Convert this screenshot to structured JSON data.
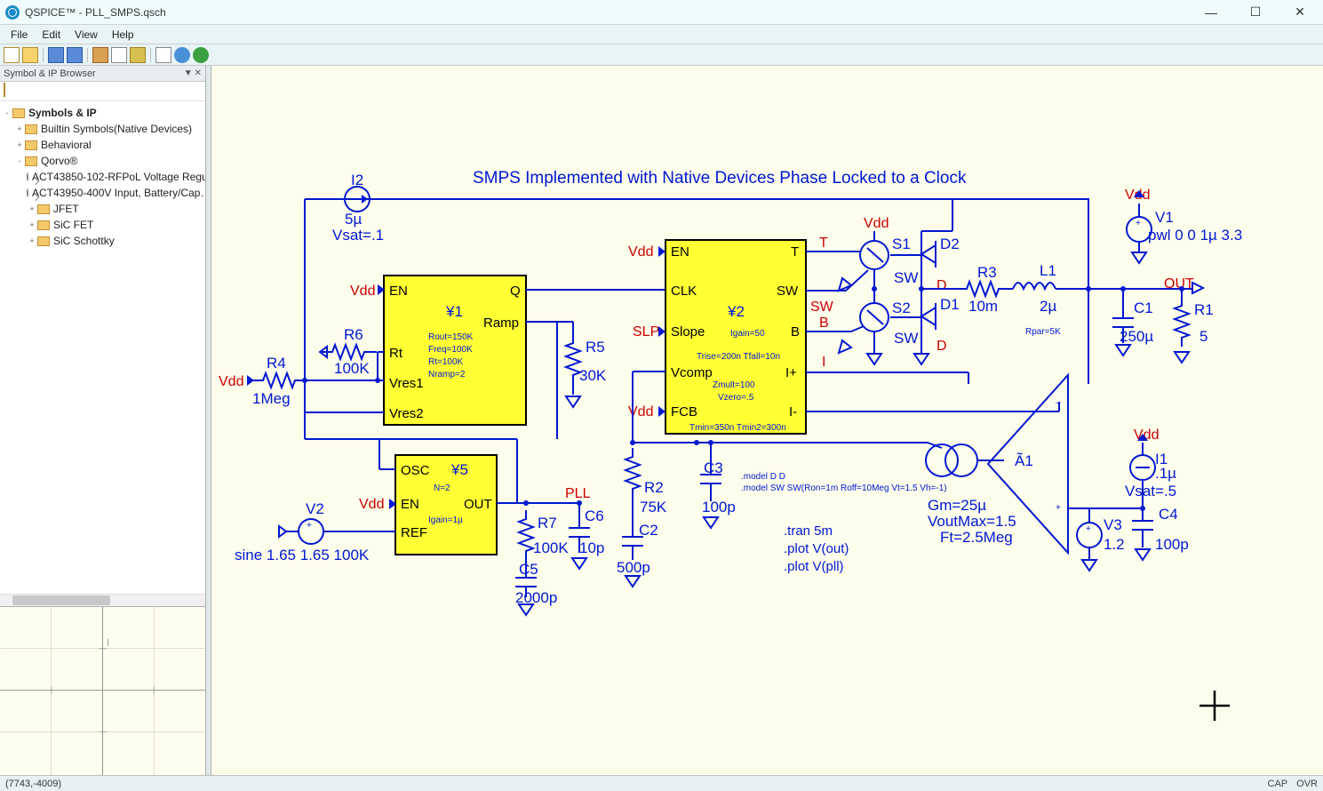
{
  "window": {
    "title": "QSPICE™ - PLL_SMPS.qsch"
  },
  "menus": [
    "File",
    "Edit",
    "View",
    "Help"
  ],
  "sidebar": {
    "title": "Symbol & IP Browser",
    "root": "Symbols & IP",
    "nodes": [
      {
        "label": "Builtin Symbols(Native Devices)",
        "indent": 1,
        "type": "folder",
        "toggle": "+"
      },
      {
        "label": "Behavioral",
        "indent": 1,
        "type": "folder",
        "toggle": "+"
      },
      {
        "label": "Qorvo®",
        "indent": 1,
        "type": "folder",
        "toggle": "-"
      },
      {
        "label": "ACT43850-102-RFPoL Voltage Regu",
        "indent": 2,
        "type": "leaf",
        "toggle": ""
      },
      {
        "label": "ACT43950-400V Input, Battery/Cap…",
        "indent": 2,
        "type": "leaf",
        "toggle": ""
      },
      {
        "label": "JFET",
        "indent": 2,
        "type": "folder",
        "toggle": "+"
      },
      {
        "label": "SiC FET",
        "indent": 2,
        "type": "folder",
        "toggle": "+"
      },
      {
        "label": "SiC Schottky",
        "indent": 2,
        "type": "folder",
        "toggle": "+"
      }
    ]
  },
  "status": {
    "coords": "(7743,-4009)",
    "cap": "CAP",
    "ovr": "OVR"
  },
  "schematic": {
    "title": "SMPS Implemented with Native Devices Phase Locked to a Clock",
    "nets": {
      "vdd": "Vdd",
      "slp": "SLP",
      "pll": "PLL",
      "sw": "SW",
      "t": "T",
      "b": "B",
      "i": "I",
      "d": "D",
      "out": "OUT"
    },
    "comps": {
      "I2": {
        "ref": "I2",
        "val": "5µ",
        "note": "Vsat=.1"
      },
      "Y1": {
        "ref": "¥1",
        "pins": {
          "en": "EN",
          "q": "Q",
          "ramp": "Ramp",
          "rt": "Rt",
          "vres1": "Vres1",
          "vres2": "Vres2"
        },
        "params": [
          "Rout=150K",
          "Freq=100K",
          "Rt=100K",
          "Nramp=2"
        ]
      },
      "Y2": {
        "ref": "¥2",
        "pins": {
          "en": "EN",
          "t": "T",
          "clk": "CLK",
          "sw": "SW",
          "slope": "Slope",
          "b": "B",
          "vcomp": "Vcomp",
          "ip": "I+",
          "fcb": "FCB",
          "im": "I-"
        },
        "params": [
          "Igain=50",
          "Trise=200n Tfall=10n",
          "Zmult=100",
          "Vzero=.5",
          "Tmin=350n Tmin2=300n"
        ]
      },
      "Y5": {
        "ref": "¥5",
        "pins": {
          "osc": "OSC",
          "en": "EN",
          "out": "OUT",
          "ref": "REF"
        },
        "params": [
          "N=2",
          "Igain=1µ"
        ]
      },
      "R4": {
        "ref": "R4",
        "val": "1Meg"
      },
      "R6": {
        "ref": "R6",
        "val": "100K"
      },
      "R5": {
        "ref": "R5",
        "val": "30K"
      },
      "R7": {
        "ref": "R7",
        "val": "100K"
      },
      "R2": {
        "ref": "R2",
        "val": "75K"
      },
      "R3": {
        "ref": "R3",
        "val": "10m"
      },
      "R1": {
        "ref": "R1",
        "val": "5"
      },
      "C5": {
        "ref": "C5",
        "val": "2000p"
      },
      "C6": {
        "ref": "C6",
        "val": "10p"
      },
      "C2": {
        "ref": "C2",
        "val": "500p"
      },
      "C3": {
        "ref": "C3",
        "val": "100p"
      },
      "C1": {
        "ref": "C1",
        "val": "250µ"
      },
      "C4": {
        "ref": "C4",
        "val": "100p"
      },
      "L1": {
        "ref": "L1",
        "val": "2µ",
        "note": "Rpar=5K"
      },
      "D1": {
        "ref": "D1"
      },
      "D2": {
        "ref": "D2"
      },
      "S1": {
        "ref": "S1",
        "val": "SW"
      },
      "S2": {
        "ref": "S2",
        "val": "SW"
      },
      "V1": {
        "ref": "V1",
        "val": "pwl 0 0 1µ 3.3"
      },
      "V2": {
        "ref": "V2",
        "val": "sine 1.65 1.65 100K"
      },
      "V3": {
        "ref": "V3",
        "val": "1.2"
      },
      "I1": {
        "ref": "I1",
        "val": ".1µ",
        "note": "Vsat=.5"
      },
      "A1": {
        "ref": "Ã1",
        "params": [
          "Gm=25µ",
          "VoutMax=1.5",
          "Ft=2.5Meg"
        ]
      }
    },
    "directives": [
      ".model D D",
      ".model SW SW(Ron=1m Roff=10Meg Vt=1.5 Vh=-1)",
      ".tran 5m",
      ".plot V(out)",
      ".plot V(pll)"
    ]
  }
}
